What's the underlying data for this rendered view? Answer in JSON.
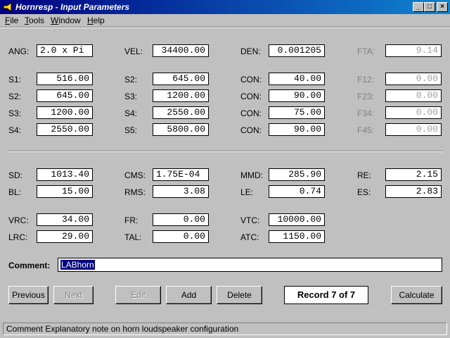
{
  "window": {
    "title": "Hornresp - Input Parameters"
  },
  "title_buttons": {
    "minimize": "_",
    "maximize": "□",
    "close": "×"
  },
  "menu": [
    {
      "label": "File",
      "accel": "F",
      "rest": "ile"
    },
    {
      "label": "Tools",
      "accel": "T",
      "rest": "ools"
    },
    {
      "label": "Window",
      "accel": "W",
      "rest": "indow"
    },
    {
      "label": "Help",
      "accel": "H",
      "rest": "elp"
    }
  ],
  "params": {
    "ang": {
      "label": "ANG:",
      "value": "2.0 x Pi"
    },
    "vel": {
      "label": "VEL:",
      "value": "34400.00"
    },
    "den": {
      "label": "DEN:",
      "value": "0.001205"
    },
    "fta": {
      "label": "FTA:",
      "value": "9.14"
    },
    "s1": {
      "label": "S1:",
      "value": "516.00"
    },
    "s2": {
      "label": "S2:",
      "value": "645.00"
    },
    "s3": {
      "label": "S3:",
      "value": "1200.00"
    },
    "s4": {
      "label": "S4:",
      "value": "2550.00"
    },
    "s2b": {
      "label": "S2:",
      "value": "645.00"
    },
    "s3b": {
      "label": "S3:",
      "value": "1200.00"
    },
    "s4b": {
      "label": "S4:",
      "value": "2550.00"
    },
    "s5": {
      "label": "S5:",
      "value": "5800.00"
    },
    "con1": {
      "label": "CON:",
      "value": "40.00"
    },
    "con2": {
      "label": "CON:",
      "value": "90.00"
    },
    "con3": {
      "label": "CON:",
      "value": "75.00"
    },
    "con4": {
      "label": "CON:",
      "value": "90.00"
    },
    "f12": {
      "label": "F12:",
      "value": "0.00"
    },
    "f23": {
      "label": "F23:",
      "value": "0.00"
    },
    "f34": {
      "label": "F34:",
      "value": "0.00"
    },
    "f45": {
      "label": "F45:",
      "value": "0.00"
    },
    "sd": {
      "label": "SD:",
      "value": "1013.40"
    },
    "bl": {
      "label": "BL:",
      "value": "15.00"
    },
    "cms": {
      "label": "CMS:",
      "value": "1.75E-04"
    },
    "rms": {
      "label": "RMS:",
      "value": "3.08"
    },
    "mmd": {
      "label": "MMD:",
      "value": "285.90"
    },
    "le": {
      "label": "LE:",
      "value": "0.74"
    },
    "re": {
      "label": "RE:",
      "value": "2.15"
    },
    "es": {
      "label": "ES:",
      "value": "2.83"
    },
    "vrc": {
      "label": "VRC:",
      "value": "34.00"
    },
    "lrc": {
      "label": "LRC:",
      "value": "29.00"
    },
    "fr": {
      "label": "FR:",
      "value": "0.00"
    },
    "tal": {
      "label": "TAL:",
      "value": "0.00"
    },
    "vtc": {
      "label": "VTC:",
      "value": "10000.00"
    },
    "atc": {
      "label": "ATC:",
      "value": "1150.00"
    }
  },
  "comment": {
    "label": "Comment:",
    "value": "LABhorn"
  },
  "buttons": {
    "previous": "Previous",
    "next": "Next",
    "edit": "Edit",
    "add": "Add",
    "delete": "Delete",
    "calculate": "Calculate"
  },
  "record": "Record 7 of 7",
  "status": "Comment   Explanatory note on horn loudspeaker configuration"
}
